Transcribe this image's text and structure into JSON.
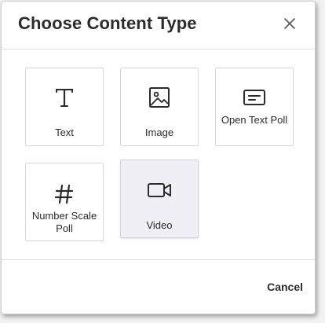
{
  "dialog": {
    "title": "Choose Content Type",
    "close_icon": "close-icon",
    "cancel_label": "Cancel"
  },
  "tiles": [
    {
      "label": "Text",
      "icon": "text-icon",
      "selected": false
    },
    {
      "label": "Image",
      "icon": "image-icon",
      "selected": false
    },
    {
      "label": "Open Text Poll",
      "icon": "open-text-poll-icon",
      "selected": false
    },
    {
      "label": "Number Scale Poll",
      "icon": "hash-icon",
      "selected": false
    },
    {
      "label": "Video",
      "icon": "video-camera-icon",
      "selected": true
    }
  ],
  "colors": {
    "text": "#2b2b2b",
    "border": "#d6d6d6",
    "selected_background": "#f0eff5"
  }
}
